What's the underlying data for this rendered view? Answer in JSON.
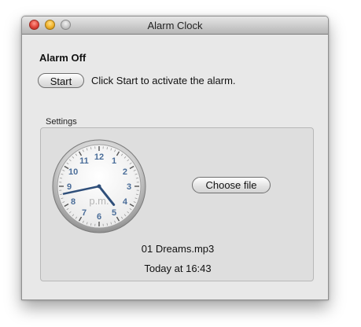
{
  "window": {
    "title": "Alarm Clock"
  },
  "alarm": {
    "status": "Alarm Off",
    "start_label": "Start",
    "hint": "Click Start to activate the alarm."
  },
  "settings": {
    "label": "Settings",
    "choose_file_label": "Choose file",
    "file_name": "01 Dreams.mp3",
    "alarm_time": "Today at 16:43"
  },
  "clock": {
    "period": "p.m.",
    "hour": 16,
    "minute": 43,
    "numerals": [
      "12",
      "1",
      "2",
      "3",
      "4",
      "5",
      "6",
      "7",
      "8",
      "9",
      "10",
      "11"
    ],
    "numeral_color": "#4a6d99",
    "hand_color": "#2f4f7a"
  }
}
